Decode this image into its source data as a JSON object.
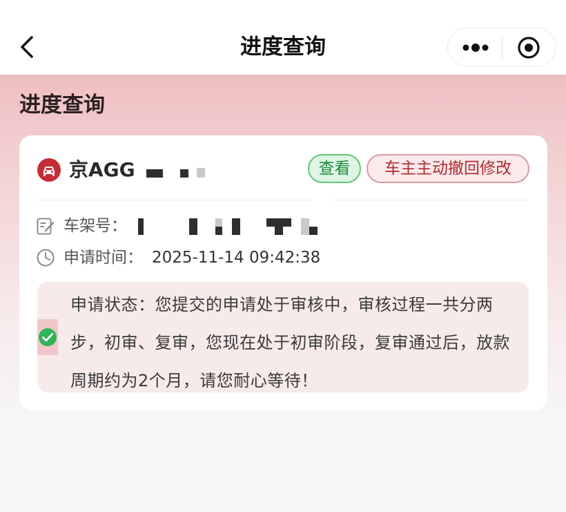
{
  "navbar": {
    "title": "进度查询",
    "back_icon": "chevron-left-icon",
    "more_icon": "more-dots-icon",
    "target_icon": "record-target-icon"
  },
  "page": {
    "section_title": "进度查询"
  },
  "card": {
    "plate": "京AGG",
    "badges": {
      "view": "查看",
      "revoke": "车主主动撤回修改"
    },
    "vin": {
      "label": "车架号：",
      "icon": "edit-icon"
    },
    "apply_time": {
      "label": "申请时间：",
      "value": "2025-11-14 09:42:38",
      "icon": "clock-icon"
    },
    "status": {
      "text": "申请状态：您提交的申请处于审核中，审核过程一共分两步，初审、复审，您现在处于初审阶段，复审通过后，放款周期约为2个月，请您耐心等待！",
      "icon": "check-circle-icon"
    }
  },
  "colors": {
    "accent_red": "#c62d34",
    "success_green": "#2fb457",
    "hero_pink": "#efbfc1"
  }
}
